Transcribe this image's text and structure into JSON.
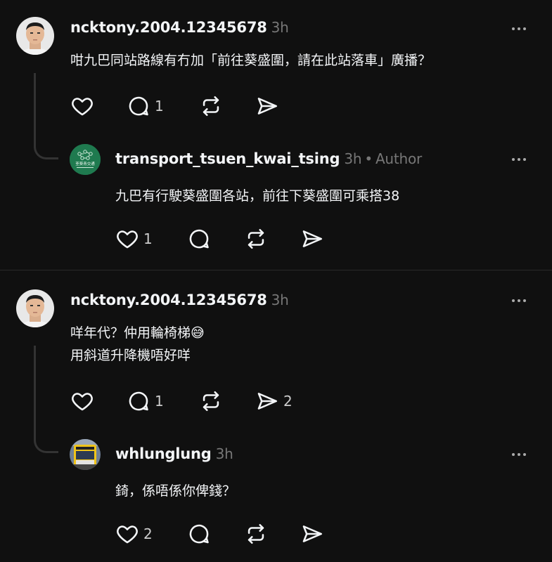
{
  "threads": [
    {
      "comment": {
        "username": "ncktony.2004.12345678",
        "time": "3h",
        "text": "咁九巴同站路線有冇加「前往葵盛圍，請在此站落車」廣播？",
        "replies_count": "1"
      },
      "reply": {
        "username": "transport_tsuen_kwai_tsing",
        "time": "3h",
        "badge": "Author",
        "text": "九巴有行駛葵盛圍各站，前往下葵盛圍可乘搭38",
        "likes_count": "1",
        "avatar_text": "荃葵青交通"
      }
    },
    {
      "comment": {
        "username": "ncktony.2004.12345678",
        "time": "3h",
        "text": "咩年代？仲用輪椅梯😅\n用斜道升降機唔好咩",
        "replies_count": "1",
        "shares_count": "2"
      },
      "reply": {
        "username": "whlunglung",
        "time": "3h",
        "text": "錡，係唔係你俾錢？",
        "likes_count": "2"
      }
    }
  ],
  "colors": {
    "background": "#101010",
    "text": "#f3f5f7",
    "muted": "#777777",
    "line": "#333333",
    "transport_avatar": "#1f7a4f"
  },
  "icons": [
    "heart-icon",
    "comment-icon",
    "repost-icon",
    "share-icon",
    "more-icon"
  ]
}
